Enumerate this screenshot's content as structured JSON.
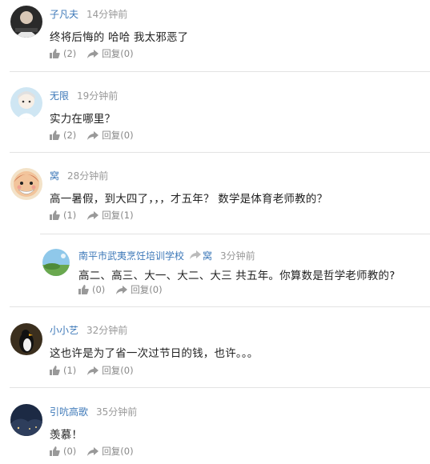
{
  "comments": [
    {
      "name": "子凡夫",
      "time": "14分钟前",
      "content": "终将后悔的 哈哈 我太邪恶了",
      "like_count": "(2)",
      "reply_label": "回复",
      "reply_count": "(0)",
      "avatar_icon": "dark-portrait-avatar"
    },
    {
      "name": "无限",
      "time": "19分钟前",
      "content": "实力在哪里？",
      "like_count": "(2)",
      "reply_label": "回复",
      "reply_count": "(0)",
      "avatar_icon": "cartoon-character-avatar"
    },
    {
      "name": "窝",
      "time": "28分钟前",
      "content": "高一暑假，到大四了，，，才五年？ 数学是体育老师教的？",
      "like_count": "(1)",
      "reply_label": "回复",
      "reply_count": "(1)",
      "avatar_icon": "cartoon-old-man-avatar"
    },
    {
      "name": "小小艺",
      "time": "32分钟前",
      "content": "这也许是为了省一次过节日的钱，也许。。。",
      "like_count": "(1)",
      "reply_label": "回复",
      "reply_count": "(0)",
      "avatar_icon": "penguin-avatar"
    },
    {
      "name": "引吭高歌",
      "time": "35分钟前",
      "content": "羡慕！",
      "like_count": "(0)",
      "reply_label": "回复",
      "reply_count": "(0)",
      "avatar_icon": "night-landscape-avatar"
    }
  ],
  "reply": {
    "name": "南平市武夷烹饪培训学校",
    "reply_to": "窝",
    "time": "3分钟前",
    "content": "高二、高三、大一、大二、大三 共五年。你算数是哲学老师教的?",
    "like_count": "(0)",
    "reply_label": "回复",
    "reply_count": "(0)",
    "avatar_icon": "landscape-avatar"
  },
  "colors": {
    "name_link": "#3d78b8",
    "meta_gray": "#999999",
    "divider": "#e3e3e3"
  }
}
